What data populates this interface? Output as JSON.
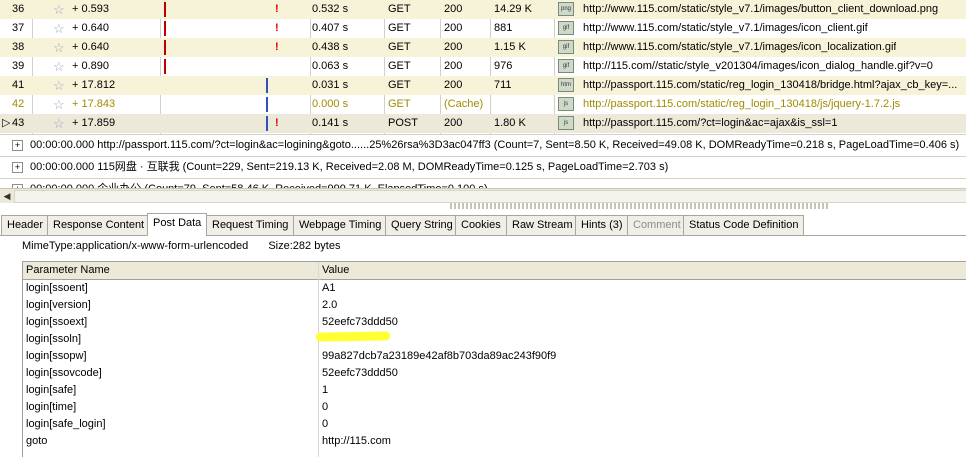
{
  "requests": [
    {
      "num": "36",
      "offset": "+ 0.593",
      "time": "0.532 s",
      "method": "GET",
      "status": "200",
      "size": "14.29 K",
      "icon": "png-file-icon",
      "icon_label": "png",
      "url": "http://www.115.com/static/style_v7.1/images/button_client_download.png",
      "alert": true,
      "state": "alt"
    },
    {
      "num": "37",
      "offset": "+ 0.640",
      "time": "0.407 s",
      "method": "GET",
      "status": "200",
      "size": "881",
      "icon": "gif-file-icon",
      "icon_label": "gif",
      "url": "http://www.115.com/static/style_v7.1/images/icon_client.gif",
      "alert": true,
      "state": ""
    },
    {
      "num": "38",
      "offset": "+ 0.640",
      "time": "0.438 s",
      "method": "GET",
      "status": "200",
      "size": "1.15 K",
      "icon": "gif-file-icon",
      "icon_label": "gif",
      "url": "http://www.115.com/static/style_v7.1/images/icon_localization.gif",
      "alert": true,
      "state": "alt"
    },
    {
      "num": "39",
      "offset": "+ 0.890",
      "time": "0.063 s",
      "method": "GET",
      "status": "200",
      "size": "976",
      "icon": "gif-file-icon",
      "icon_label": "gif",
      "url": "http://115.com//static/style_v201304/images/icon_dialog_handle.gif?v=0",
      "alert": false,
      "state": ""
    },
    {
      "num": "41",
      "offset": "+ 17.812",
      "time": "0.031 s",
      "method": "GET",
      "status": "200",
      "size": "711",
      "icon": "html-file-icon",
      "icon_label": "htm",
      "url": "http://passport.115.com/static/reg_login_130418/bridge.html?ajax_cb_key=...",
      "alert": false,
      "state": "alt"
    },
    {
      "num": "42",
      "offset": "+ 17.843",
      "time": "0.000 s",
      "method": "GET",
      "status": "(Cache)",
      "size": "",
      "icon": "js-file-icon",
      "icon_label": "js",
      "url": "http://passport.115.com/static/reg_login_130418/js/jquery-1.7.2.js",
      "alert": false,
      "state": "cache"
    },
    {
      "num": "43",
      "offset": "+ 17.859",
      "time": "0.141 s",
      "method": "POST",
      "status": "200",
      "size": "1.80 K",
      "icon": "js-file-icon",
      "icon_label": "js",
      "url": "http://passport.115.com/?ct=login&ac=ajax&is_ssl=1",
      "alert": true,
      "state": "sel"
    }
  ],
  "sessions": [
    {
      "label": "00:00:00.000  http://passport.115.com/?ct=login&ac=logining&goto......25%26rsa%3D3ac047ff3  (Count=7, Sent=8.50 K, Received=49.08 K, DOMReadyTime=0.218 s, PageLoadTime=0.406 s)"
    },
    {
      "label": "00:00:00.000  115网盘 · 互联我  (Count=229, Sent=219.13 K, Received=2.08 M, DOMReadyTime=0.125 s, PageLoadTime=2.703 s)"
    },
    {
      "label": "00:00:00.000  企业办公  (Count=79, Sent=58.46 K, Received=999.71 K, ElapsedTime=0.100 s)"
    }
  ],
  "tabs": [
    "Header",
    "Response Content",
    "Post Data",
    "Request Timing",
    "Webpage Timing",
    "Query String",
    "Cookies",
    "Raw Stream",
    "Hints (3)",
    "Comment",
    "Status Code Definition"
  ],
  "active_tab": "Post Data",
  "disabled_tab": "Comment",
  "mime_type": "MimeType:application/x-www-form-urlencoded",
  "size_label": "Size:282 bytes",
  "params": {
    "col_name": "Parameter Name",
    "col_value": "Value",
    "rows": [
      {
        "name": "login[ssoent]",
        "value": "A1"
      },
      {
        "name": "login[version]",
        "value": "2.0"
      },
      {
        "name": "login[ssoext]",
        "value": "52eefc73ddd50"
      },
      {
        "name": "login[ssoln]",
        "value": ""
      },
      {
        "name": "login[ssopw]",
        "value": "99a827dcb7a23189e42af8b703da89ac243f90f9"
      },
      {
        "name": "login[ssovcode]",
        "value": "52eefc73ddd50"
      },
      {
        "name": "login[safe]",
        "value": "1"
      },
      {
        "name": "login[time]",
        "value": "0"
      },
      {
        "name": "login[safe_login]",
        "value": "0"
      },
      {
        "name": "goto",
        "value": "http://115.com"
      }
    ]
  },
  "colors": {
    "highlight": "#ffff33",
    "alert": "#e00000",
    "cache_text": "#a08c00",
    "alt_row": "#f7f3d9"
  }
}
